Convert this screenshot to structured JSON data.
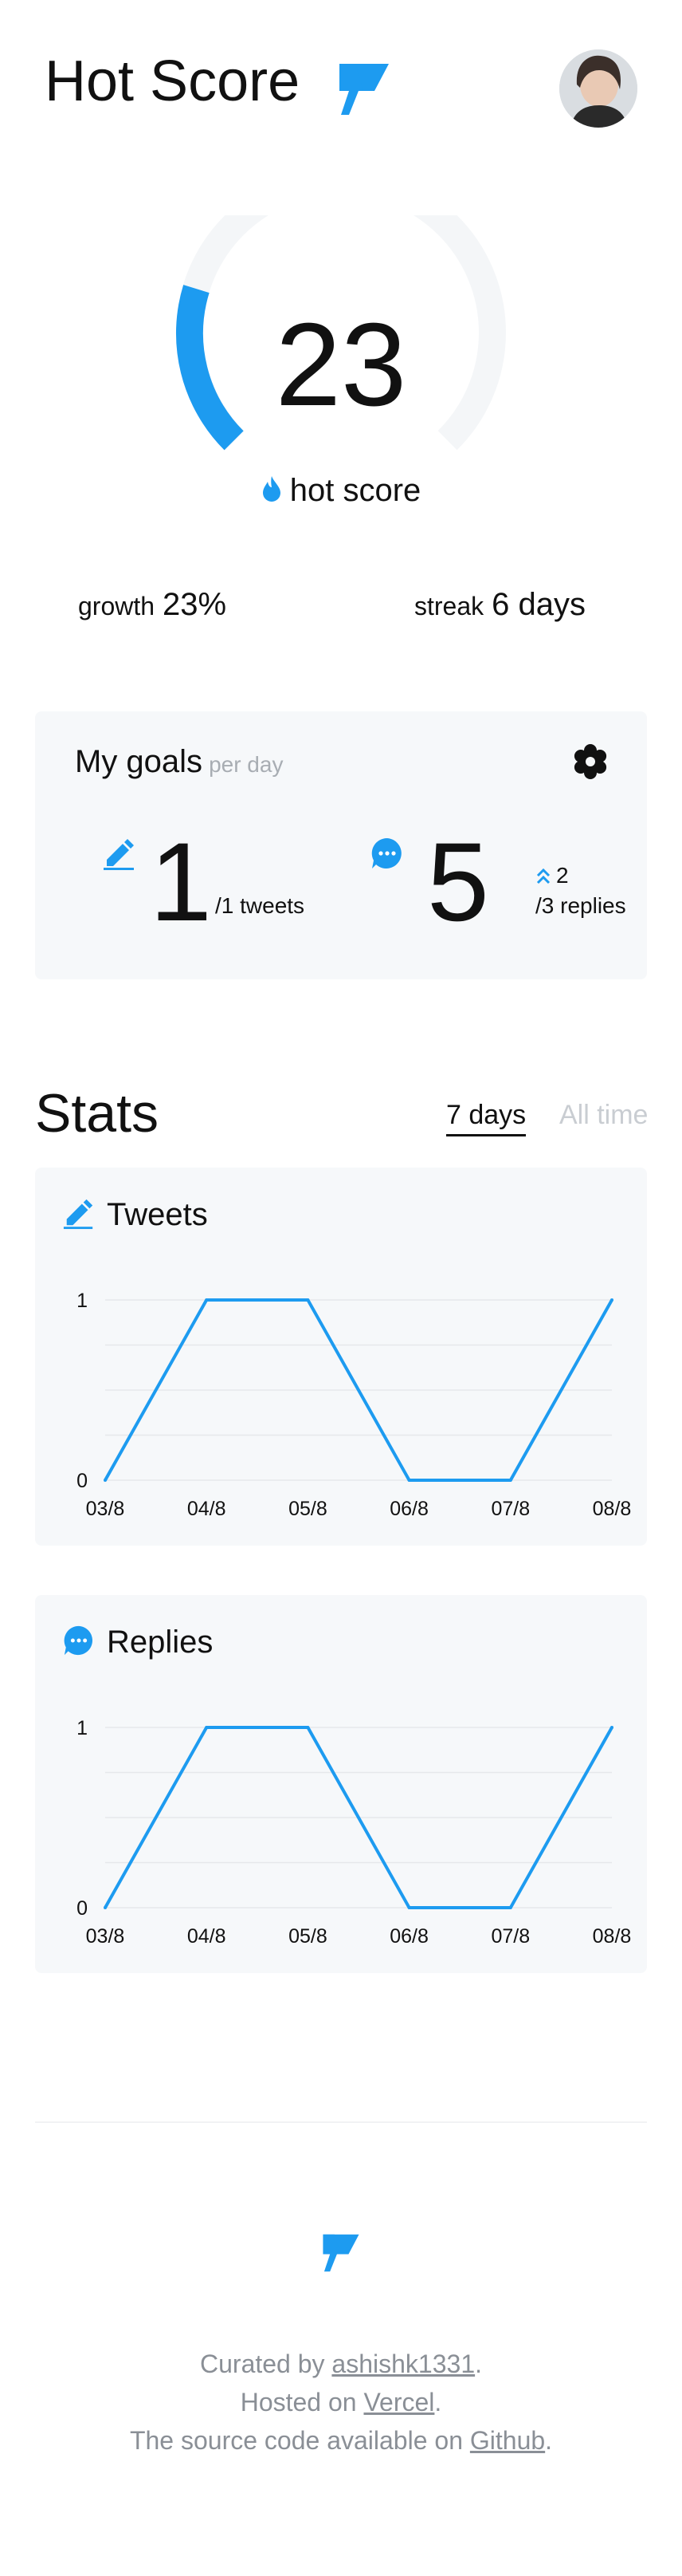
{
  "header": {
    "title": "Hot Score"
  },
  "score": {
    "value": "23",
    "label": "hot score",
    "gauge_fraction": 0.23
  },
  "metrics": {
    "growth": {
      "label": "growth",
      "value": "23%"
    },
    "streak": {
      "label": "streak",
      "value": "6 days"
    }
  },
  "goals": {
    "title": "My goals",
    "subtitle": "per day",
    "tweets": {
      "count": "1",
      "target": "/1 tweets"
    },
    "replies": {
      "count": "5",
      "delta": "2",
      "target": "/3 replies"
    }
  },
  "stats": {
    "title": "Stats",
    "tabs": [
      {
        "label": "7 days",
        "active": true
      },
      {
        "label": "All time",
        "active": false
      }
    ]
  },
  "chart_data": [
    {
      "type": "line",
      "title": "Tweets",
      "categories": [
        "03/8",
        "04/8",
        "05/8",
        "06/8",
        "07/8",
        "08/8"
      ],
      "series": [
        {
          "values": [
            0,
            1,
            1,
            0,
            0,
            1
          ]
        }
      ],
      "yticks": [
        "1",
        "0"
      ],
      "ylim": [
        0,
        1
      ],
      "grid": true,
      "color": "#1d9bf0"
    },
    {
      "type": "line",
      "title": "Replies",
      "categories": [
        "03/8",
        "04/8",
        "05/8",
        "06/8",
        "07/8",
        "08/8"
      ],
      "series": [
        {
          "values": [
            0,
            1,
            1,
            0,
            0,
            1
          ]
        }
      ],
      "yticks": [
        "1",
        "0"
      ],
      "ylim": [
        0,
        1
      ],
      "grid": true,
      "color": "#1d9bf0"
    }
  ],
  "footer": {
    "curated_prefix": "Curated by ",
    "curated_link": "ashishk1331",
    "hosted_prefix": "Hosted on ",
    "hosted_link": "Vercel",
    "source_prefix": "The source code available on ",
    "source_link": "Github",
    "period": "."
  },
  "colors": {
    "accent": "#1d9bf0",
    "card_bg": "#f6f8fa",
    "muted": "#a8adb3",
    "gauge_track": "#f4f6f8"
  },
  "icons": [
    "flag-logo-icon",
    "fire-icon",
    "gear-icon",
    "pencil-icon",
    "chat-bubble-icon",
    "chevrons-up-icon"
  ]
}
